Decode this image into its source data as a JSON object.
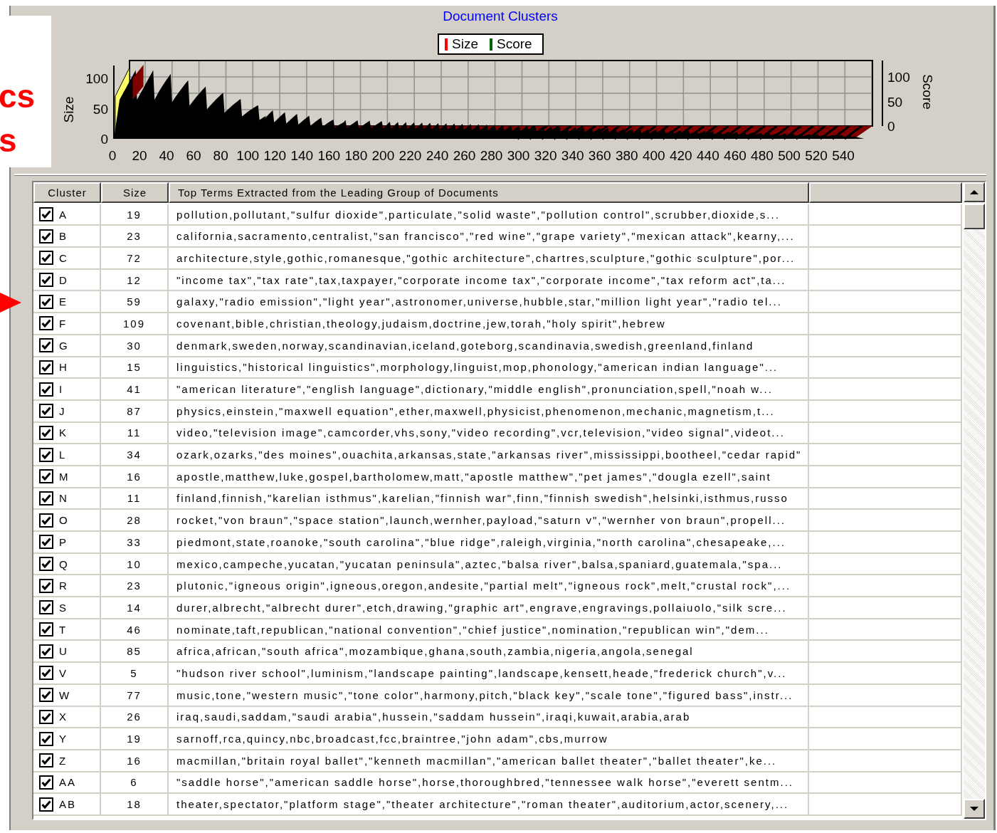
{
  "overlay": {
    "lines": [
      "cs",
      "s"
    ]
  },
  "chart": {
    "title": "Document Clusters",
    "legend": [
      {
        "label": "Size",
        "color": "#ff0000"
      },
      {
        "label": "Score",
        "color": "#006400"
      }
    ],
    "y_left_title": "Size",
    "y_left_ticks": [
      "100",
      "50",
      "0"
    ],
    "y_right_title": "Score",
    "y_right_ticks": [
      "100",
      "50",
      "0"
    ],
    "x_ticks": [
      "0",
      "20",
      "40",
      "60",
      "80",
      "100",
      "120",
      "140",
      "160",
      "180",
      "200",
      "220",
      "240",
      "260",
      "280",
      "300",
      "320",
      "340",
      "360",
      "380",
      "400",
      "420",
      "440",
      "460",
      "480",
      "500",
      "520",
      "540"
    ]
  },
  "table": {
    "columns": [
      "Cluster",
      "Size",
      "Top Terms Extracted from the Leading Group of Documents"
    ],
    "rows": [
      {
        "cluster": "A",
        "size": "19",
        "terms": "pollution,pollutant,\"sulfur dioxide\",particulate,\"solid waste\",\"pollution control\",scrubber,dioxide,s...",
        "checked": true
      },
      {
        "cluster": "B",
        "size": "23",
        "terms": "california,sacramento,centralist,\"san francisco\",\"red wine\",\"grape variety\",\"mexican attack\",kearny,...",
        "checked": true
      },
      {
        "cluster": "C",
        "size": "72",
        "terms": "architecture,style,gothic,romanesque,\"gothic architecture\",chartres,sculpture,\"gothic sculpture\",por...",
        "checked": true
      },
      {
        "cluster": "D",
        "size": "12",
        "terms": "\"income tax\",\"tax rate\",tax,taxpayer,\"corporate income tax\",\"corporate income\",\"tax reform act\",ta...",
        "checked": true
      },
      {
        "cluster": "E",
        "size": "59",
        "terms": "galaxy,\"radio emission\",\"light year\",astronomer,universe,hubble,star,\"million light year\",\"radio tel...",
        "checked": true
      },
      {
        "cluster": "F",
        "size": "109",
        "terms": "covenant,bible,christian,theology,judaism,doctrine,jew,torah,\"holy spirit\",hebrew",
        "checked": true
      },
      {
        "cluster": "G",
        "size": "30",
        "terms": "denmark,sweden,norway,scandinavian,iceland,goteborg,scandinavia,swedish,greenland,finland",
        "checked": true
      },
      {
        "cluster": "H",
        "size": "15",
        "terms": "linguistics,\"historical linguistics\",morphology,linguist,mop,phonology,\"american indian language\"...",
        "checked": true
      },
      {
        "cluster": "I",
        "size": "41",
        "terms": "\"american literature\",\"english language\",dictionary,\"middle english\",pronunciation,spell,\"noah w...",
        "checked": true
      },
      {
        "cluster": "J",
        "size": "87",
        "terms": "physics,einstein,\"maxwell equation\",ether,maxwell,physicist,phenomenon,mechanic,magnetism,t...",
        "checked": true
      },
      {
        "cluster": "K",
        "size": "11",
        "terms": "video,\"television image\",camcorder,vhs,sony,\"video recording\",vcr,television,\"video signal\",videot...",
        "checked": true
      },
      {
        "cluster": "L",
        "size": "34",
        "terms": "ozark,ozarks,\"des moines\",ouachita,arkansas,state,\"arkansas river\",mississippi,bootheel,\"cedar rapid\"",
        "checked": true
      },
      {
        "cluster": "M",
        "size": "16",
        "terms": "apostle,matthew,luke,gospel,bartholomew,matt,\"apostle matthew\",\"pet james\",\"dougla ezell\",saint",
        "checked": true
      },
      {
        "cluster": "N",
        "size": "11",
        "terms": "finland,finnish,\"karelian isthmus\",karelian,\"finnish war\",finn,\"finnish swedish\",helsinki,isthmus,russo",
        "checked": true
      },
      {
        "cluster": "O",
        "size": "28",
        "terms": "rocket,\"von braun\",\"space station\",launch,wernher,payload,\"saturn v\",\"wernher von braun\",propell...",
        "checked": true
      },
      {
        "cluster": "P",
        "size": "33",
        "terms": "piedmont,state,roanoke,\"south carolina\",\"blue ridge\",raleigh,virginia,\"north carolina\",chesapeake,...",
        "checked": true
      },
      {
        "cluster": "Q",
        "size": "10",
        "terms": "mexico,campeche,yucatan,\"yucatan peninsula\",aztec,\"balsa river\",balsa,spaniard,guatemala,\"spa...",
        "checked": true
      },
      {
        "cluster": "R",
        "size": "23",
        "terms": "plutonic,\"igneous origin\",igneous,oregon,andesite,\"partial melt\",\"igneous rock\",melt,\"crustal rock\",...",
        "checked": true
      },
      {
        "cluster": "S",
        "size": "14",
        "terms": "durer,albrecht,\"albrecht durer\",etch,drawing,\"graphic art\",engrave,engravings,pollaiuolo,\"silk scre...",
        "checked": true
      },
      {
        "cluster": "T",
        "size": "46",
        "terms": "nominate,taft,republican,\"national convention\",\"chief justice\",nomination,\"republican win\",\"dem...",
        "checked": true
      },
      {
        "cluster": "U",
        "size": "85",
        "terms": "africa,african,\"south africa\",mozambique,ghana,south,zambia,nigeria,angola,senegal",
        "checked": true
      },
      {
        "cluster": "V",
        "size": "5",
        "terms": "\"hudson river school\",luminism,\"landscape painting\",landscape,kensett,heade,\"frederick church\",v...",
        "checked": true
      },
      {
        "cluster": "W",
        "size": "77",
        "terms": "music,tone,\"western music\",\"tone color\",harmony,pitch,\"black key\",\"scale tone\",\"figured bass\",instr...",
        "checked": true
      },
      {
        "cluster": "X",
        "size": "26",
        "terms": "iraq,saudi,saddam,\"saudi arabia\",hussein,\"saddam hussein\",iraqi,kuwait,arabia,arab",
        "checked": true
      },
      {
        "cluster": "Y",
        "size": "19",
        "terms": "sarnoff,rca,quincy,nbc,broadcast,fcc,braintree,\"john adam\",cbs,murrow",
        "checked": true
      },
      {
        "cluster": "Z",
        "size": "16",
        "terms": "macmillan,\"britain royal ballet\",\"kenneth macmillan\",\"american ballet theater\",\"ballet theater\",ke...",
        "checked": true
      },
      {
        "cluster": "AA",
        "size": "6",
        "terms": "\"saddle horse\",\"american saddle horse\",horse,thoroughbred,\"tennessee walk horse\",\"everett sentm...",
        "checked": true
      },
      {
        "cluster": "AB",
        "size": "18",
        "terms": "theater,spectator,\"platform stage\",\"theater architecture\",\"roman theater\",auditorium,actor,scenery,...",
        "checked": true
      }
    ]
  }
}
